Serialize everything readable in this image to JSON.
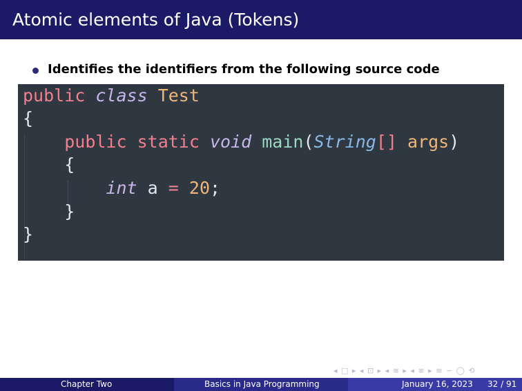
{
  "slide": {
    "title": "Atomic elements of Java (Tokens)",
    "bullet": "Identifies the identifiers from the following source code"
  },
  "code": {
    "public1": "public",
    "class_kw": "class",
    "class_name": "Test",
    "open1": "{",
    "public2": "public",
    "static_kw": "static",
    "void_kw": "void",
    "method": "main",
    "paren_open": "(",
    "string_type": "String",
    "brackets": "[]",
    "args": "args",
    "paren_close": ")",
    "open2": "{",
    "int_kw": "int",
    "var": "a",
    "eq": "=",
    "num": "20",
    "semi": ";",
    "close2": "}",
    "close1": "}"
  },
  "nav": {
    "symbols": "◂ □ ▸ ◂ ⊡ ▸ ◂ ≡ ▸ ◂ ≡ ▸ ≡ ∽ ◯ ⟲"
  },
  "footer": {
    "left": "Chapter Two",
    "center": "Basics in Java Programming",
    "date": "January 16, 2023",
    "page": "32 / 91"
  },
  "colors": {
    "title_bar": "#1a1a66",
    "code_bg": "#2f3740",
    "keyword": "#f27f8d",
    "class_name": "#f0b678",
    "method": "#9ad9c0",
    "type": "#8ab8e6"
  }
}
